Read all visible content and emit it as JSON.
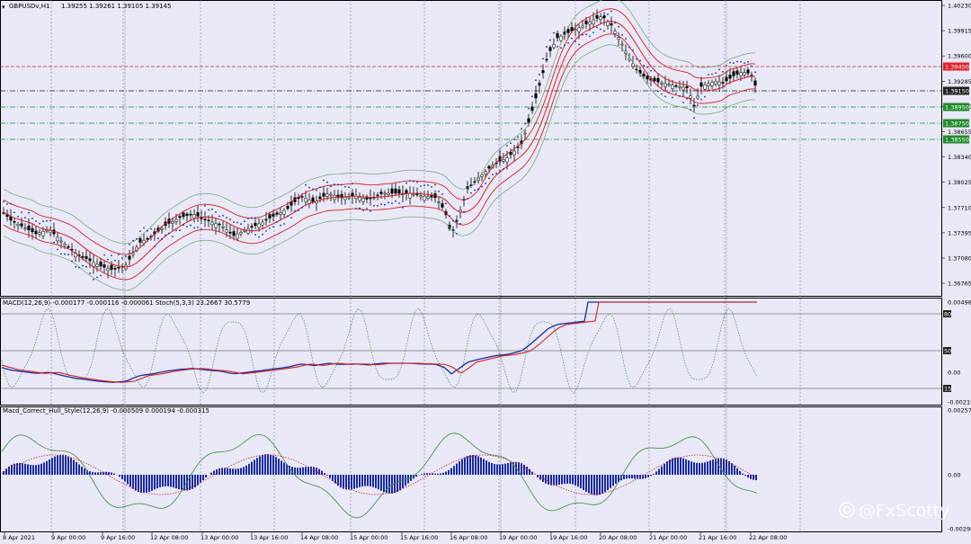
{
  "main_chart": {
    "title": "GBPUSDv,H1",
    "ohlc": "1.39255 1.39261 1.39105 1.39145",
    "price_axis": [
      "1.40230",
      "1.39915",
      "1.39600",
      "1.39285",
      "1.38970",
      "1.38655",
      "1.38340",
      "1.38025",
      "1.37710",
      "1.37395",
      "1.37080",
      "1.36765"
    ],
    "price_tags": [
      {
        "label": "1.39450",
        "color": "#e0202a"
      },
      {
        "label": "1.39150",
        "color": "#202020"
      },
      {
        "label": "1.38950",
        "color": "#1f8a2a"
      },
      {
        "label": "1.38750",
        "color": "#1f8a2a"
      },
      {
        "label": "1.38550",
        "color": "#1f8a2a"
      }
    ]
  },
  "indicator1": {
    "title": "MACD(12,26,9) -0.000177 -0.000116 -0.000061  Stoch(5,3,3) 23.2667 30.5779",
    "axis": [
      "0.004988",
      "0.00",
      "-0.002195"
    ],
    "level_tags": [
      "80",
      "50",
      "15"
    ]
  },
  "indicator2": {
    "title": "Macd_Correct_Hull_Style(12,26,9) -0.000509 0.000194 -0.000315",
    "axis": [
      "0.002573",
      "0.00",
      "-0.002986"
    ]
  },
  "time_axis": [
    "8 Apr 2021",
    "9 Apr 00:00",
    "9 Apr 16:00",
    "12 Apr 08:00",
    "13 Apr 00:00",
    "13 Apr 16:00",
    "14 Apr 08:00",
    "15 Apr 00:00",
    "15 Apr 16:00",
    "16 Apr 08:00",
    "19 Apr 00:00",
    "19 Apr 16:00",
    "20 Apr 08:00",
    "21 Apr 00:00",
    "21 Apr 16:00",
    "22 Apr 08:00"
  ],
  "watermark": "@FxScotty",
  "colors": {
    "background": "#e8e8f6",
    "bollinger_mid": "#d42020",
    "bollinger_outer": "#6aa36a",
    "parabolic_sar": "#1a2aa0",
    "macd_main": "#1a2aa0",
    "macd_signal": "#d42020",
    "stoch_dotted": "#3a8a3a",
    "hist_bar": "#1a2aa0"
  }
}
